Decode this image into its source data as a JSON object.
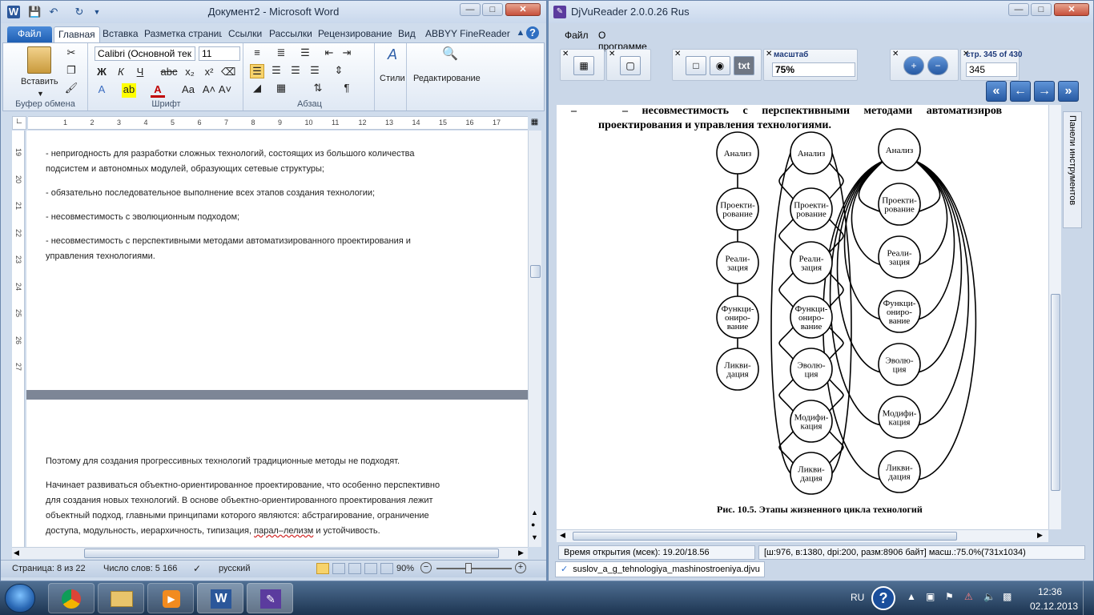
{
  "word": {
    "title": "Документ2 - Microsoft Word",
    "tabs": [
      "Файл",
      "Главная",
      "Вставка",
      "Разметка страниц",
      "Ссылки",
      "Рассылки",
      "Рецензирование",
      "Вид",
      "ABBYY FineReader"
    ],
    "font_name": "Calibri (Основной тек",
    "font_size": "11",
    "paste_label": "Вставить",
    "styles_label": "Стили",
    "editing_label": "Редактирование",
    "groups": [
      "Буфер обмена",
      "Шрифт",
      "Абзац"
    ],
    "ruler_h": [
      "1",
      "2",
      "3",
      "4",
      "5",
      "6",
      "7",
      "8",
      "9",
      "10",
      "11",
      "12",
      "13",
      "14",
      "15",
      "16",
      "17"
    ],
    "ruler_v": [
      "19",
      "20",
      "21",
      "22",
      "23",
      "24",
      "25",
      "26",
      "27"
    ],
    "page1": [
      "- непригодность для разработки сложных технологий, состоящих из большого количества",
      "подсистем и автономных модулей, образующих сетевые структуры;",
      "- обязательно последовательное выполнение всех этапов создания технологии;",
      "- несовместимость с эволюционным подходом;",
      "- несовместимость с перспективными методами автоматизированного проектирования и",
      "управления технологиями."
    ],
    "page2": [
      "Поэтому для создания прогрессивных технологий традиционные методы не подходят.",
      "Начинает развиваться объектно-ориентированное проектирование, что особенно перспективно",
      "для создания новых технологий. В основе объектно-ориентированного проектирования лежит",
      "объектный подход, главными принципами которого являются: абстрагирование, ограничение",
      "доступа, модульность, иерархичность, типизация, ",
      "парал–лелизм",
      " и устойчивость."
    ],
    "status": {
      "page": "Страница: 8 из 22",
      "words": "Число слов: 5 166",
      "lang": "русский",
      "zoom": "90%"
    }
  },
  "djvu": {
    "title": "DjVuReader 2.0.0.26 Rus",
    "menu": [
      "Файл",
      "О программе"
    ],
    "scale_label": "масштаб",
    "scale_value": "75%",
    "page_label": "стр. 345 of 430",
    "page_value": "345",
    "txt_button": "txt",
    "side_panel": "Панели инструментов",
    "doc_line1_a": "–",
    "doc_line1_b": "– несовместимость с перспективными методами автоматизиров",
    "doc_line2": "проектирования и управления технологиями.",
    "col1": [
      "Анализ",
      "Проекти-\nрование",
      "Реали-\nзация",
      "Функци-\nониро-\nвание",
      "Ликви-\nдация"
    ],
    "col2": [
      "Анализ",
      "Проекти-\nрование",
      "Реали-\nзация",
      "Функци-\nониро-\nвание",
      "Эволю-\nция",
      "Модифи-\nкация",
      "Ликви-\nдация"
    ],
    "col3": [
      "Анализ",
      "Проекти-\nрование",
      "Реали-\nзация",
      "Функци-\nониро-\nвание",
      "Эволю-\nция",
      "Модифи-\nкация",
      "Ликви-\nдация"
    ],
    "caption": "Рис. 10.5. Этапы жизненного цикла технологий",
    "status_time": "Время открытия (мсек): 19.20/18.56",
    "status_info": "[ш:976, в:1380, dpi:200, разм:8906 байт] масш.:75.0%(731x1034)",
    "file_tab": "suslov_a_g_tehnologiya_mashinostroeniya.djvu"
  },
  "taskbar": {
    "lang": "RU",
    "time": "12:36",
    "date": "02.12.2013"
  }
}
